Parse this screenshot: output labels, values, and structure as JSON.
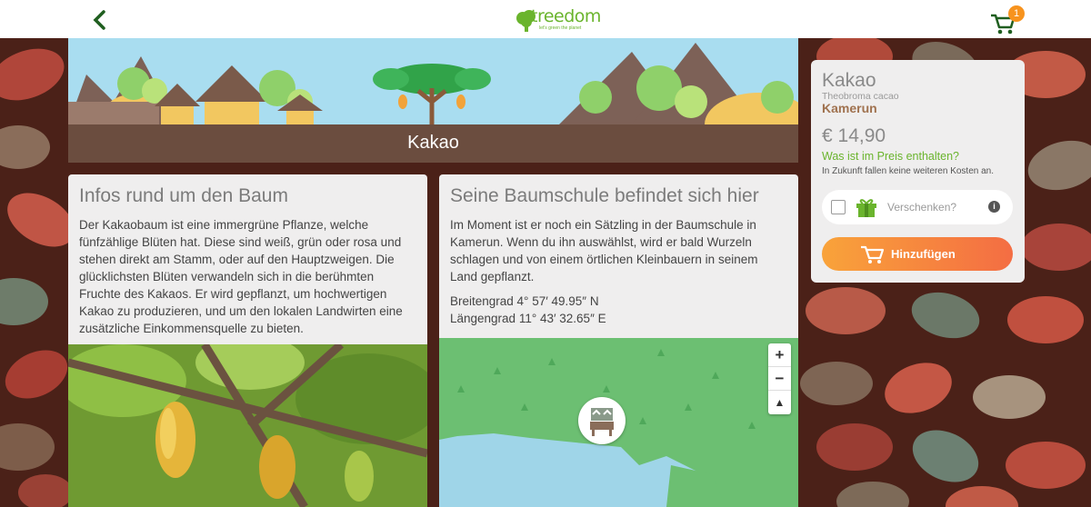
{
  "topbar": {
    "logo_text": "treedom",
    "logo_tagline": "let's green the planet",
    "cart_count": "1"
  },
  "hero": {
    "title": "Kakao"
  },
  "info": {
    "title": "Infos rund um den Baum",
    "text": "Der Kakaobaum ist eine immergrüne Pflanze, welche fünfzählige Blüten hat. Diese sind weiß, grün oder rosa und stehen direkt am Stamm, oder auf den Hauptzweigen. Die glücklichsten Blüten verwandeln sich in die berühmten Fruchte des Kakaos. Er wird gepflanzt, um hochwertigen Kakao zu produzieren, und um den lokalen Landwirten eine zusätzliche Einkommensquelle zu bieten."
  },
  "nursery": {
    "title": "Seine Baumschule befindet sich hier",
    "text": "Im Moment ist er noch ein Sätzling in der Baumschule in Kamerun. Wenn du ihn auswählst, wird er bald Wurzeln schlagen und von einem örtlichen Kleinbauern in seinem Land gepflanzt.",
    "latitude": "Breitengrad 4° 57′ 49.95″ N",
    "longitude": "Längengrad 11° 43′ 32.65″ E"
  },
  "map": {
    "zoom_in": "+",
    "zoom_out": "−",
    "reset_north": "▲"
  },
  "panel": {
    "name": "Kakao",
    "latin": "Theobroma cacao",
    "country": "Kamerun",
    "price": "€ 14,90",
    "price_link": "Was ist im Preis enthalten?",
    "note": "In Zukunft fallen keine weiteren Kosten an.",
    "gift_label": "Verschenken?",
    "info_symbol": "i",
    "add_label": "Hinzufügen"
  },
  "colors": {
    "brand_green": "#6ab42d",
    "hero_band": "#6b4d3f",
    "add_gradient_start": "#f9a33a",
    "add_gradient_end": "#f46d43",
    "country_brown": "#a0724f"
  }
}
